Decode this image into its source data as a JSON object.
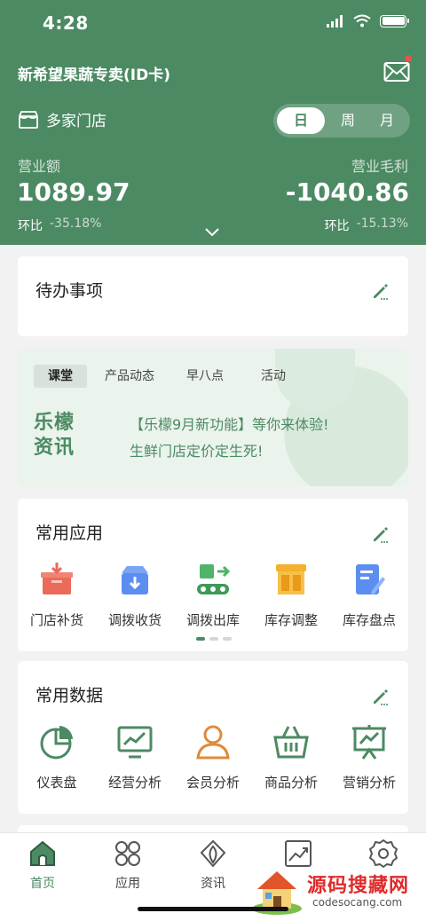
{
  "status_bar": {
    "time": "4:28"
  },
  "header": {
    "store_name": "新希望果蔬专卖(ID卡)",
    "multi_store": "多家门店",
    "segments": [
      "日",
      "周",
      "月"
    ],
    "revenue_label": "营业额",
    "revenue_value": "1089.97",
    "revenue_cmp_label": "环比",
    "revenue_cmp_value": "-35.18%",
    "profit_label": "营业毛利",
    "profit_value": "-1040.86",
    "profit_cmp_label": "环比",
    "profit_cmp_value": "-15.13%"
  },
  "todo": {
    "title": "待办事项"
  },
  "news": {
    "tabs": [
      "课堂",
      "产品动态",
      "早八点",
      "活动"
    ],
    "logo": "乐檬资讯",
    "lines": [
      "【乐檬9月新功能】等你来体验!",
      "生鲜门店定价定生死!"
    ]
  },
  "apps": {
    "title": "常用应用",
    "items": [
      {
        "label": "门店补货",
        "icon": "restock-box-icon"
      },
      {
        "label": "调拨收货",
        "icon": "transfer-receive-icon"
      },
      {
        "label": "调拨出库",
        "icon": "transfer-out-icon"
      },
      {
        "label": "库存调整",
        "icon": "warehouse-icon"
      },
      {
        "label": "库存盘点",
        "icon": "inventory-check-icon"
      }
    ]
  },
  "data_section": {
    "title": "常用数据",
    "items": [
      {
        "label": "仪表盘",
        "icon": "pie-chart-icon"
      },
      {
        "label": "经营分析",
        "icon": "line-chart-monitor-icon"
      },
      {
        "label": "会员分析",
        "icon": "member-icon"
      },
      {
        "label": "商品分析",
        "icon": "basket-icon"
      },
      {
        "label": "营销分析",
        "icon": "presentation-board-icon"
      }
    ]
  },
  "tabbar": {
    "items": [
      {
        "label": "首页",
        "icon": "home-icon"
      },
      {
        "label": "应用",
        "icon": "apps-grid-icon"
      },
      {
        "label": "资讯",
        "icon": "news-leaf-icon"
      },
      {
        "label": "",
        "icon": "trend-chart-icon"
      },
      {
        "label": "",
        "icon": "settings-gear-icon"
      }
    ]
  },
  "watermark": {
    "title": "源码搜藏网",
    "url": "codesocang.com"
  },
  "colors": {
    "brand": "#4c8a63",
    "accent_red": "#e02a2a"
  }
}
